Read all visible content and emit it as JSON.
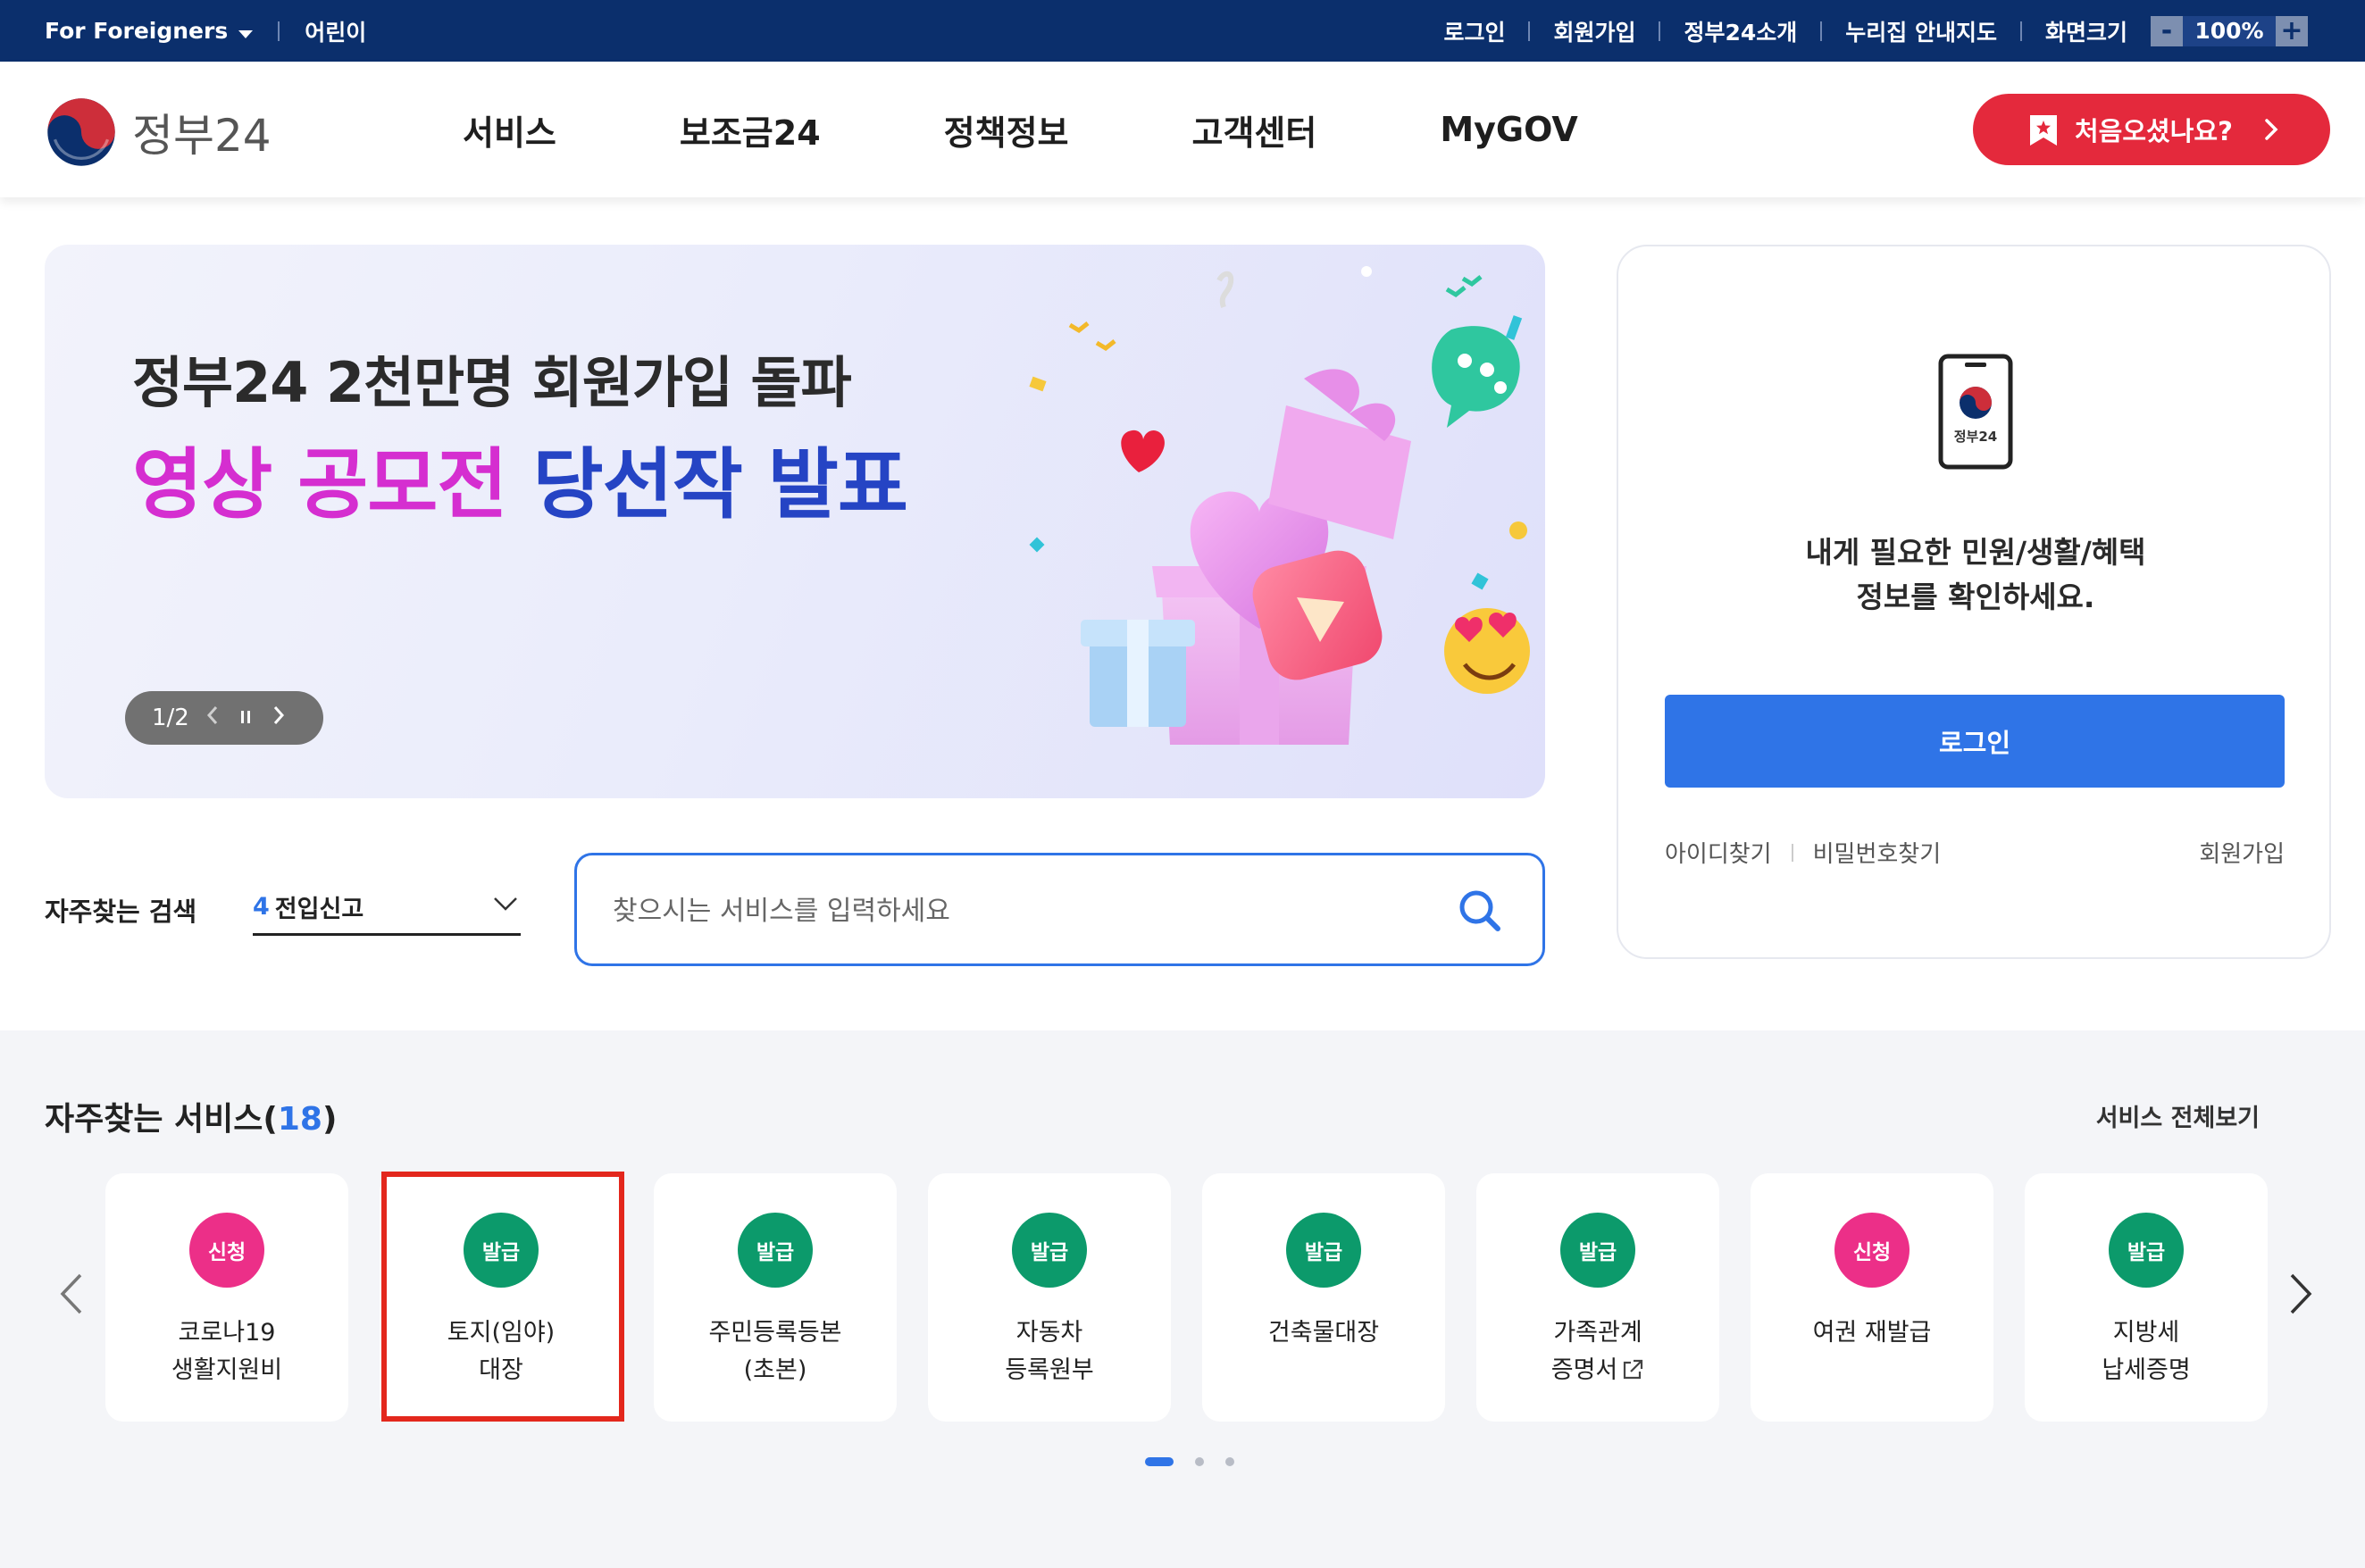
{
  "topbar": {
    "foreigners": "For Foreigners",
    "kids": "어린이",
    "login": "로그인",
    "signup": "회원가입",
    "about": "정부24소개",
    "nuri": "누리집 안내지도",
    "screen_size": "화면크기",
    "zoom_minus": "-",
    "zoom_value": "100%",
    "zoom_plus": "+"
  },
  "header": {
    "logo_text": "정부24",
    "nav": [
      "서비스",
      "보조금24",
      "정책정보",
      "고객센터",
      "MyGOV"
    ],
    "first_visit": "처음오셨나요?"
  },
  "banner": {
    "line1": "정부24  2천만명 회원가입 돌파",
    "line2_a": "영상 공모전",
    "line2_b": "당선작 발표",
    "pager": "1/2"
  },
  "login_panel": {
    "msg_line1": "내게 필요한 민원/생활/혜택",
    "msg_line2": "정보를 확인하세요.",
    "login_button": "로그인",
    "find_id": "아이디찾기",
    "find_pw": "비밀번호찾기",
    "join": "회원가입"
  },
  "search": {
    "freq_label": "자주찾는 검색",
    "selected_num": "4",
    "selected_text": "전입신고",
    "placeholder": "찾으시는 서비스를 입력하세요"
  },
  "services": {
    "title": "자주찾는 서비스",
    "count": "(18)",
    "count_num": "18",
    "view_all": "서비스 전체보기",
    "items": [
      {
        "badge": "신청",
        "type": "pink",
        "line1": "코로나19",
        "line2": "생활지원비"
      },
      {
        "badge": "발급",
        "type": "green",
        "line1": "토지(임야)",
        "line2": "대장"
      },
      {
        "badge": "발급",
        "type": "green",
        "line1": "주민등록등본",
        "line2": "(초본)"
      },
      {
        "badge": "발급",
        "type": "green",
        "line1": "자동차",
        "line2": "등록원부"
      },
      {
        "badge": "발급",
        "type": "green",
        "line1": "건축물대장",
        "line2": ""
      },
      {
        "badge": "발급",
        "type": "green",
        "line1": "가족관계",
        "line2": "증명서"
      },
      {
        "badge": "신청",
        "type": "pink",
        "line1": "여권 재발급",
        "line2": ""
      },
      {
        "badge": "발급",
        "type": "green",
        "line1": "지방세",
        "line2": "납세증명"
      }
    ]
  },
  "colors": {
    "topbar": "#0b2f6c",
    "accent_blue": "#2f74e7",
    "cta_red": "#e4293c",
    "badge_green": "#0c9a6b",
    "badge_pink": "#ec2f88",
    "highlight_red": "#e3271c"
  }
}
